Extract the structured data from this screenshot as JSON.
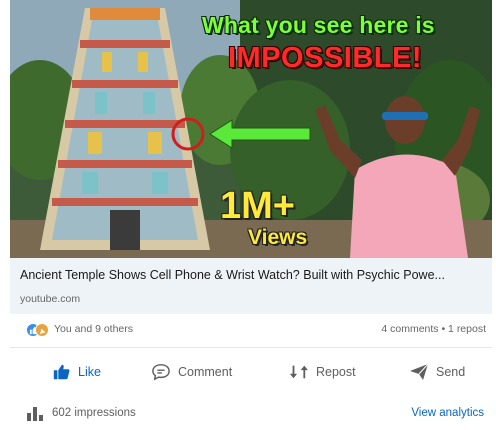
{
  "thumbnail": {
    "headline_top": "What you see here is",
    "headline_bottom": "IMPOSSIBLE!",
    "views_count": "1M+",
    "views_label": "Views"
  },
  "link_preview": {
    "title": "Ancient Temple Shows Cell Phone & Wrist Watch? Built with Psychic Powe...",
    "source": "youtube.com"
  },
  "social": {
    "reactions_text": "You and 9 others",
    "counts_text": "4 comments • 1 repost"
  },
  "actions": {
    "like": "Like",
    "comment": "Comment",
    "repost": "Repost",
    "send": "Send"
  },
  "footer": {
    "impressions": "602 impressions",
    "analytics": "View analytics"
  },
  "colors": {
    "linkedin_blue": "#0a66c2",
    "headline_green": "#7cff3a",
    "headline_red": "#ff2b2b",
    "views_yellow": "#ffe93a"
  }
}
